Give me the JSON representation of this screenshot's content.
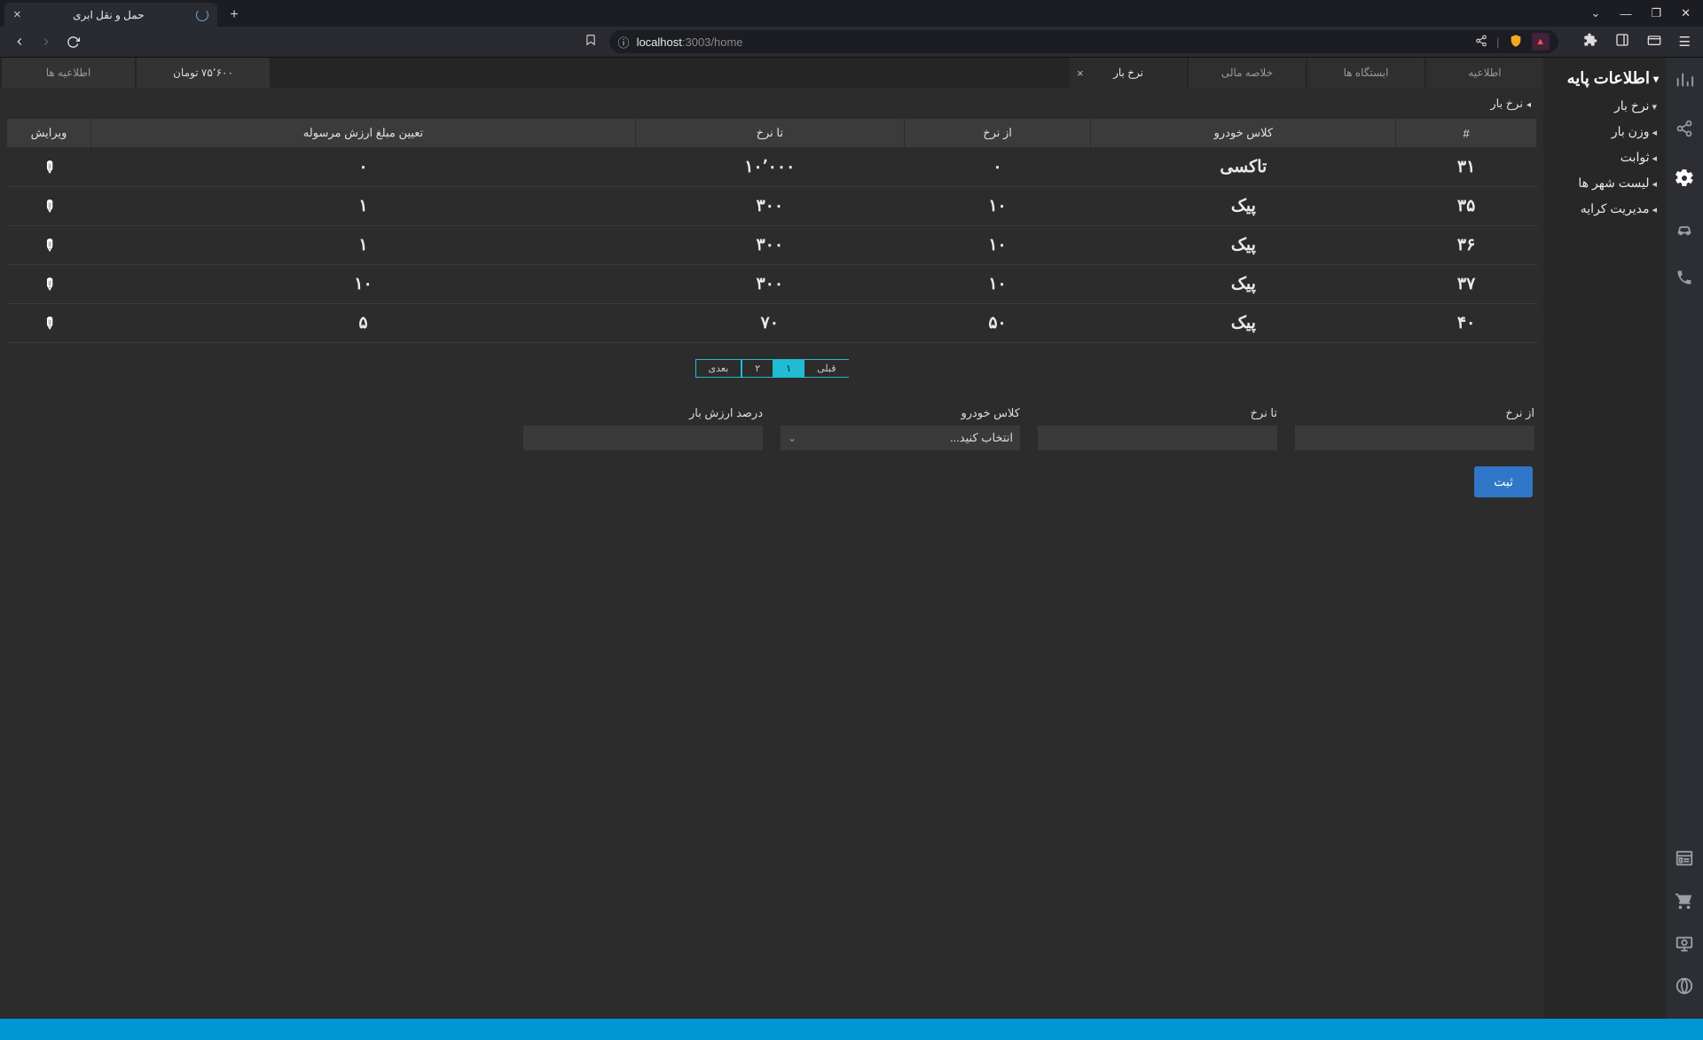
{
  "browser": {
    "tab_title": "حمل و نقل ابری",
    "url_host": "localhost",
    "url_port_path": ":3003/home"
  },
  "window": {
    "min": "—",
    "max": "❐",
    "close": "✕",
    "drop": "⌄"
  },
  "sidebar": {
    "title": "اطلاعات پایه",
    "items": [
      "نرخ بار",
      "وزن بار",
      "ثوابت",
      "لیست شهر ها",
      "مدیریت کرایه"
    ]
  },
  "tabs": {
    "items": [
      {
        "label": "اطلاعیه",
        "active": false
      },
      {
        "label": "ایستگاه ها",
        "active": false
      },
      {
        "label": "خلاصه مالی",
        "active": false
      },
      {
        "label": "نرخ بار",
        "active": true,
        "closable": true
      }
    ],
    "money": "۷۵٬۶۰۰ تومان",
    "notices_small": "اطلاعیه ها"
  },
  "breadcrumb": "نرخ بار",
  "table": {
    "headers": [
      "#",
      "کلاس خودرو",
      "از نرخ",
      "تا نرخ",
      "تعیین مبلغ ارزش مرسوله",
      "ویرایش"
    ],
    "rows": [
      {
        "id": "۳۱",
        "class": "تاکسی",
        "from": "۰",
        "to": "۱۰٬۰۰۰",
        "val": "۰"
      },
      {
        "id": "۳۵",
        "class": "پیک",
        "from": "۱۰",
        "to": "۳۰۰",
        "val": "۱"
      },
      {
        "id": "۳۶",
        "class": "پیک",
        "from": "۱۰",
        "to": "۳۰۰",
        "val": "۱"
      },
      {
        "id": "۳۷",
        "class": "پیک",
        "from": "۱۰",
        "to": "۳۰۰",
        "val": "۱۰"
      },
      {
        "id": "۴۰",
        "class": "پیک",
        "from": "۵۰",
        "to": "۷۰",
        "val": "۵"
      }
    ]
  },
  "pager": {
    "prev": "قبلی",
    "pages": [
      "۱",
      "۲"
    ],
    "next": "بعدی",
    "active": 0
  },
  "form": {
    "fields": {
      "from": "از نرخ",
      "to": "تا نرخ",
      "class": "کلاس خودرو",
      "percent": "درصد ارزش بار"
    },
    "select_placeholder": "انتخاب کنید...",
    "submit": "ثبت"
  }
}
